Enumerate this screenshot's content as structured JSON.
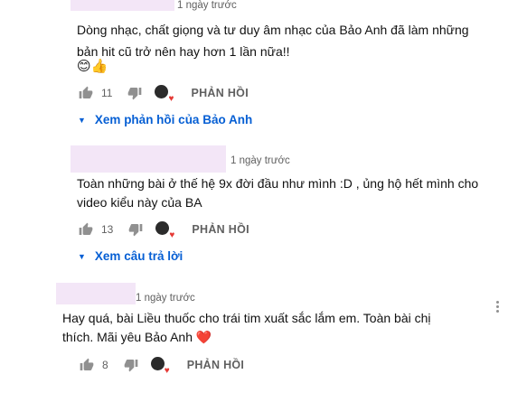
{
  "comments": [
    {
      "time": "1 ngày trước",
      "lines": [
        "Dòng nhạc, chất giọng và tư duy âm nhạc của Bảo Anh đã làm những",
        "bản hit cũ trở nên hay hơn 1 lần nữa!!"
      ],
      "emoji": "😊👍",
      "likes": "11",
      "reply_label": "PHẢN HỒI",
      "replies_link": "Xem phản hồi của Bảo Anh"
    },
    {
      "time": "1 ngày trước",
      "lines": [
        "Toàn những bài ở thế hệ 9x đời đầu như mình :D , ủng hộ hết mình cho",
        "video kiểu này của BA"
      ],
      "likes": "13",
      "reply_label": "PHẢN HỒI",
      "replies_link": "Xem câu trả lời"
    },
    {
      "time": "1 ngày trước",
      "lines": [
        "Hay quá, bài Liều thuốc cho trái tim xuất sắc lắm em. Toàn bài chị",
        "thích. Mãi yêu Bảo Anh ❤️"
      ],
      "likes": "8",
      "reply_label": "PHẢN HỒI"
    }
  ],
  "icons": {
    "like": "thumbs-up-icon",
    "dislike": "thumbs-down-icon",
    "creator_heart": "creator-heart-icon",
    "expand": "chevron-down-icon",
    "menu": "more-vert-icon"
  },
  "colors": {
    "link": "#065fd4",
    "heart": "#e53935",
    "muted": "#606060"
  }
}
